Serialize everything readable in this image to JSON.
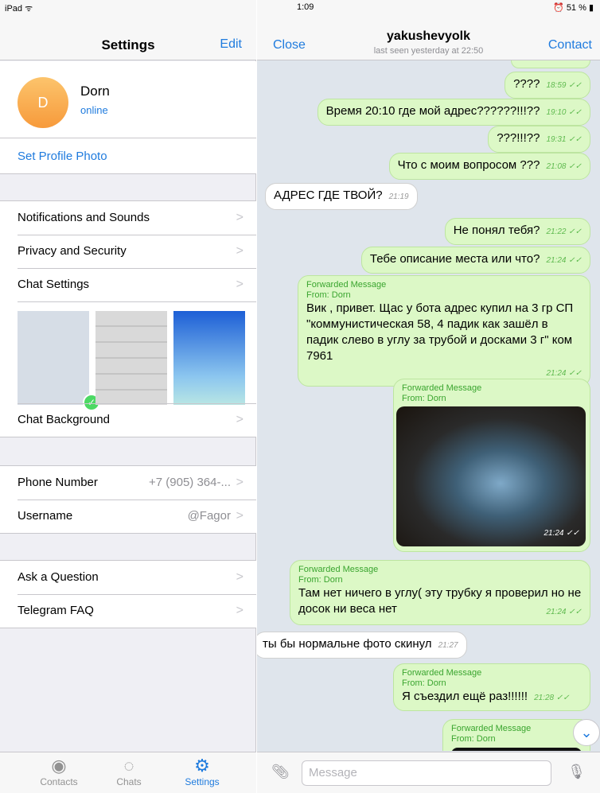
{
  "left_status": {
    "device": "iPad ᯤ"
  },
  "settings_nav": {
    "title": "Settings",
    "edit": "Edit"
  },
  "profile": {
    "initial": "D",
    "name": "Dorn",
    "status": "online",
    "set_photo": "Set Profile Photo"
  },
  "menu1": [
    {
      "label": "Notifications and Sounds"
    },
    {
      "label": "Privacy and Security"
    },
    {
      "label": "Chat Settings"
    }
  ],
  "chat_background": {
    "label": "Chat Background"
  },
  "account": {
    "phone_label": "Phone Number",
    "phone_value": "+7 (905) 364-...",
    "username_label": "Username",
    "username_value": "@Fagor"
  },
  "help": [
    {
      "label": "Ask a Question"
    },
    {
      "label": "Telegram FAQ"
    }
  ],
  "tabs": [
    {
      "label": "Contacts"
    },
    {
      "label": "Chats"
    },
    {
      "label": "Settings"
    }
  ],
  "right_status": {
    "time": "1:09",
    "battery": "⏰ 51 % ▮"
  },
  "chat_nav": {
    "close": "Close",
    "contact": "Contact",
    "username": "yakushevyolk",
    "last_seen": "last seen yesterday at 22:50"
  },
  "messages": {
    "m1": {
      "text": "????",
      "time": "18:59 ✓✓"
    },
    "m2": {
      "text": "Время 20:10 где мой адрес??????!!!??",
      "time": "19:10 ✓✓"
    },
    "m3": {
      "text": "???!!!??",
      "time": "19:31 ✓✓"
    },
    "m4": {
      "text": "Что с моим вопросом ???",
      "time": "21:08 ✓✓"
    },
    "m5": {
      "text": "АДРЕС ГДЕ ТВОЙ?",
      "time": "21:19"
    },
    "m6": {
      "text": "Не понял тебя?",
      "time": "21:22 ✓✓"
    },
    "m7": {
      "text": "Тебе описание места или что?",
      "time": "21:24 ✓✓"
    },
    "m8": {
      "fwd": "Forwarded Message",
      "from": "From: Dorn",
      "text": "Вик , привет. Щас у бота адрес купил на 3 гр СП \"коммунистическая 58, 4 падик как зашёл в падик слево в углу за трубой и досками 3 г\" ком 7961",
      "time": "21:24 ✓✓"
    },
    "m9": {
      "fwd": "Forwarded Message",
      "from": "From: Dorn",
      "time": "21:24 ✓✓"
    },
    "m10": {
      "fwd": "Forwarded Message",
      "from": "From: Dorn",
      "text": "Там нет ничего в углу( эту трубку я проверил но не досок ни веса нет",
      "time": "21:24 ✓✓"
    },
    "m11": {
      "text": "ты бы нормальне фото скинул",
      "time": "21:27"
    },
    "m12": {
      "fwd": "Forwarded Message",
      "from": "From: Dorn",
      "text": "Я съездил ещё раз!!!!!!",
      "time": "21:28 ✓✓"
    },
    "m13": {
      "fwd": "Forwarded Message",
      "from": "From: Dorn"
    }
  },
  "input": {
    "placeholder": "Message"
  }
}
